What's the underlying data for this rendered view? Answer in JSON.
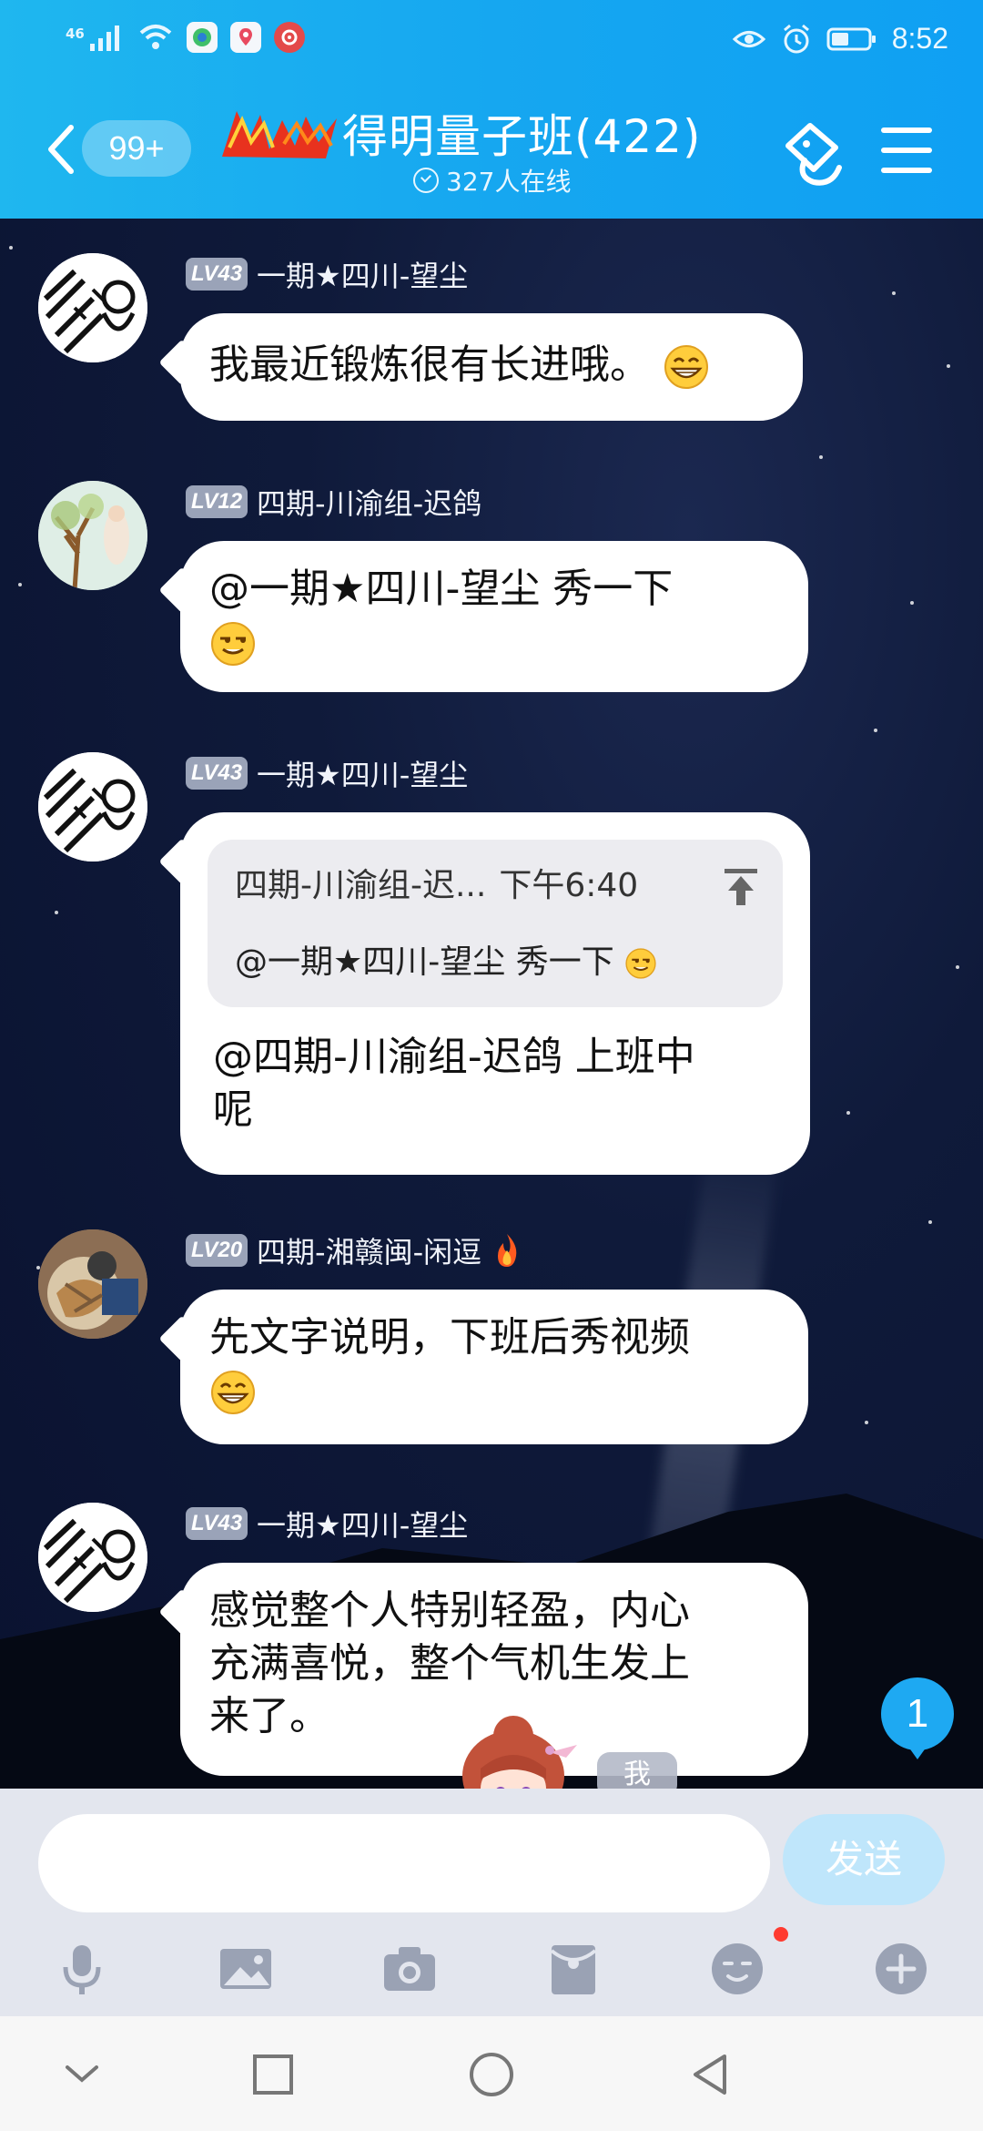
{
  "status_bar": {
    "network": "46",
    "time": "8:52"
  },
  "header": {
    "unread_count": "99+",
    "group_title": "得明量子班(422)",
    "online_text": "327人在线"
  },
  "messages": [
    {
      "level": "LV43",
      "nickname": "一期★四川-望尘",
      "text": "我最近锻炼很有长进哦。",
      "emoji": "grin-emoji"
    },
    {
      "level": "LV12",
      "nickname": "四期-川渝组-迟鸽",
      "text": "@一期★四川-望尘 秀一下",
      "emoji": "smirk-emoji"
    },
    {
      "level": "LV43",
      "nickname": "一期★四川-望尘",
      "quote": {
        "sender": "四期-川渝组-迟...",
        "time": "下午6:40",
        "text": "@一期★四川-望尘 秀一下"
      },
      "text_line1": "@四期-川渝组-迟鸽 上班中",
      "text_line2": "呢"
    },
    {
      "level": "LV20",
      "nickname": "四期-湘赣闽-闲逗",
      "text": "先文字说明，下班后秀视频",
      "emoji": "grin-emoji"
    },
    {
      "level": "LV43",
      "nickname": "一期★四川-望尘",
      "text_line1": "感觉整个人特别轻盈，内心",
      "text_line2": "充满喜悦，整个气机生发上",
      "text_line3": "来了。"
    }
  ],
  "floating": {
    "new_message_count": "1",
    "me_label": "我"
  },
  "input": {
    "value": "",
    "send_label": "发送"
  },
  "colors": {
    "header_blue": "#16a7f0",
    "send_disabled": "#bfe6fb",
    "accent_red": "#ff3b30"
  }
}
